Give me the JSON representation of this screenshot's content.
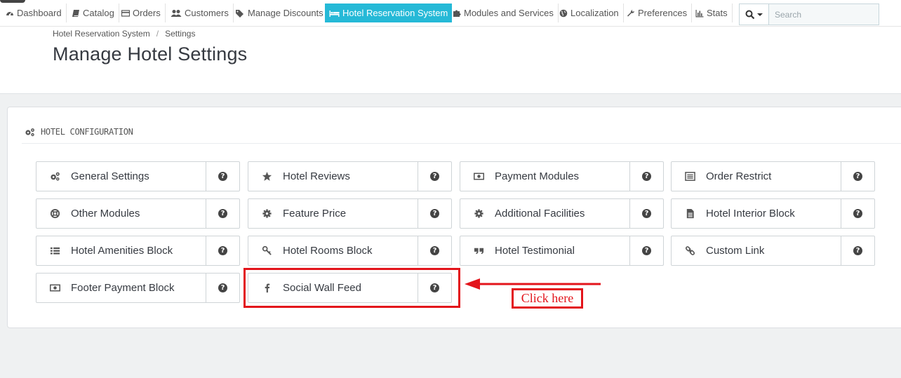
{
  "nav": {
    "items": [
      {
        "label": "Dashboard",
        "icon": "dashboard-icon",
        "active": false
      },
      {
        "label": "Catalog",
        "icon": "book-icon",
        "active": false
      },
      {
        "label": "Orders",
        "icon": "credit-card-icon",
        "active": false
      },
      {
        "label": "Customers",
        "icon": "users-icon",
        "active": false
      },
      {
        "label": "Manage Discounts",
        "icon": "tags-icon",
        "active": false
      },
      {
        "label": "Hotel Reservation System",
        "icon": "bed-icon",
        "active": true
      },
      {
        "label": "Modules and Services",
        "icon": "puzzle-icon",
        "active": false
      },
      {
        "label": "Localization",
        "icon": "globe-icon",
        "active": false
      },
      {
        "label": "Preferences",
        "icon": "wrench-icon",
        "active": false
      },
      {
        "label": "Stats",
        "icon": "bar-chart-icon",
        "active": false
      }
    ],
    "search_placeholder": "Search"
  },
  "breadcrumb": [
    "Hotel Reservation System",
    "Settings"
  ],
  "page_title": "Manage Hotel Settings",
  "panel": {
    "heading": "HOTEL CONFIGURATION",
    "settings": [
      {
        "label": "General Settings",
        "icon": "cogs-icon"
      },
      {
        "label": "Hotel Reviews",
        "icon": "star-icon"
      },
      {
        "label": "Payment Modules",
        "icon": "money-icon"
      },
      {
        "label": "Order Restrict",
        "icon": "list-alt-icon"
      },
      {
        "label": "Other Modules",
        "icon": "life-ring-icon"
      },
      {
        "label": "Feature Price",
        "icon": "gear-icon"
      },
      {
        "label": "Additional Facilities",
        "icon": "gear-icon"
      },
      {
        "label": "Hotel Interior Block",
        "icon": "file-icon"
      },
      {
        "label": "Hotel Amenities Block",
        "icon": "list-icon"
      },
      {
        "label": "Hotel Rooms Block",
        "icon": "key-icon"
      },
      {
        "label": "Hotel Testimonial",
        "icon": "quote-icon"
      },
      {
        "label": "Custom Link",
        "icon": "link-icon"
      },
      {
        "label": "Footer Payment Block",
        "icon": "money-icon"
      },
      {
        "label": "Social Wall Feed",
        "icon": "facebook-icon"
      }
    ],
    "help_glyph": "?"
  },
  "annotation": {
    "label": "Click here",
    "color": "#e3141b"
  },
  "colors": {
    "accent": "#25b9d7"
  }
}
